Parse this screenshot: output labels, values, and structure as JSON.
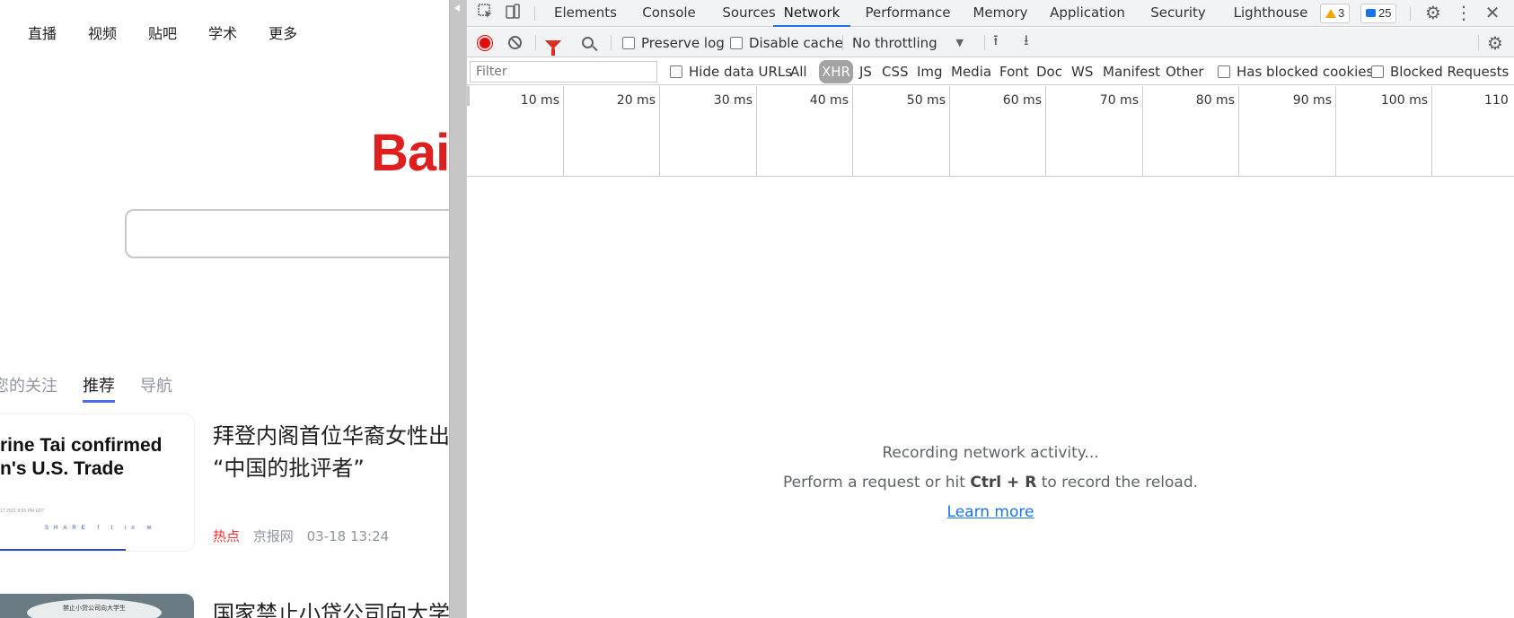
{
  "baidu": {
    "nav": [
      "直播",
      "视频",
      "贴吧",
      "学术",
      "更多"
    ],
    "logo_text": "Bai",
    "feed_tabs": [
      {
        "label": "您的关注",
        "active": false
      },
      {
        "label": "推荐",
        "active": true
      },
      {
        "label": "导航",
        "active": false
      }
    ],
    "news": [
      {
        "thumb_headline_1": "rine Tai confirmed",
        "thumb_headline_2": "n's U.S. Trade",
        "thumb_meta": "17 2021 8:55 PM EDT",
        "thumb_share": "SHARE f t in ✉",
        "title_1": "拜登内阁首位华裔女性出",
        "title_2": "“中国的批评者”",
        "tag": "热点",
        "source": "京报网",
        "time": "03-18 13:24"
      },
      {
        "thumb_text": "禁止小贷公司向大学生",
        "title_1": "国家禁止小贷公司向大学"
      }
    ]
  },
  "devtools": {
    "tabs": [
      "Elements",
      "Console",
      "Sources",
      "Network",
      "Performance",
      "Memory",
      "Application",
      "Security",
      "Lighthouse"
    ],
    "active_tab": "Network",
    "warnings_count": "3",
    "messages_count": "25",
    "toolbar": {
      "preserve_log": "Preserve log",
      "disable_cache": "Disable cache",
      "throttling": "No throttling"
    },
    "filter": {
      "placeholder": "Filter",
      "hide_data_urls": "Hide data URLs",
      "types": [
        "All",
        "XHR",
        "JS",
        "CSS",
        "Img",
        "Media",
        "Font",
        "Doc",
        "WS",
        "Manifest",
        "Other"
      ],
      "active_type": "XHR",
      "has_blocked_cookies": "Has blocked cookies",
      "blocked_requests": "Blocked Requests"
    },
    "timeline_ticks": [
      "10 ms",
      "20 ms",
      "30 ms",
      "40 ms",
      "50 ms",
      "60 ms",
      "70 ms",
      "80 ms",
      "90 ms",
      "100 ms",
      "110"
    ],
    "empty_state": {
      "line1": "Recording network activity...",
      "line2_pre": "Perform a request or hit ",
      "line2_keys": "Ctrl + R",
      "line2_post": " to record the reload.",
      "link": "Learn more"
    },
    "colors": {
      "accent": "#1a73e8",
      "record": "#e20d0d",
      "filter_active": "#d93025"
    }
  }
}
